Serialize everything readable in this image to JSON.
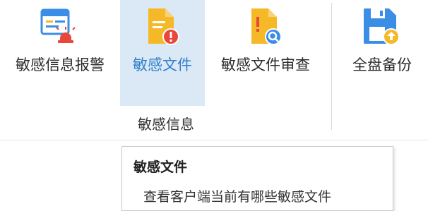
{
  "ribbon": {
    "buttons": [
      {
        "label": "敏感信息报警",
        "icon": "alert-monitor-icon",
        "active": false
      },
      {
        "label": "敏感文件",
        "icon": "document-warning-icon",
        "active": true
      },
      {
        "label": "敏感文件审查",
        "icon": "document-audit-icon",
        "active": false
      },
      {
        "label": "全盘备份",
        "icon": "floppy-upload-icon",
        "active": false
      }
    ],
    "group_label": "敏感信息"
  },
  "tooltip": {
    "title": "敏感文件",
    "description": "查看客户端当前有哪些敏感文件"
  },
  "colors": {
    "accent_blue": "#2f7ec9",
    "active_bg": "#dbe9f7",
    "doc_yellow": "#f5b928",
    "warn_red": "#e8473c",
    "backup_blue": "#3a8ee6"
  }
}
